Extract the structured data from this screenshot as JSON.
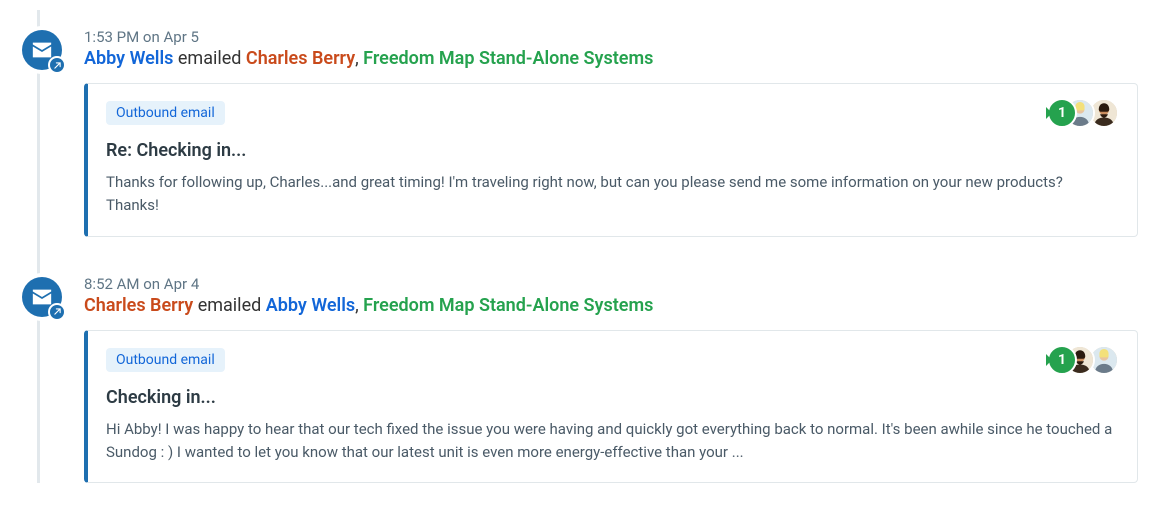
{
  "entries": [
    {
      "timestamp": "1:53 PM on Apr 5",
      "sender": {
        "name": "Abby Wells",
        "colorClass": "blue"
      },
      "action": "emailed",
      "recipient": {
        "name": "Charles Berry",
        "colorClass": "orange"
      },
      "org": "Freedom Map Stand-Alone Systems",
      "tag": "Outbound email",
      "badge_number": "1",
      "subject": "Re: Checking in...",
      "body": "Thanks for following up, Charles...and great timing! I'm traveling right now, but can you please send me some information on your new products? Thanks!",
      "avatar_order": [
        "f",
        "m"
      ]
    },
    {
      "timestamp": "8:52 AM on Apr 4",
      "sender": {
        "name": "Charles Berry",
        "colorClass": "orange"
      },
      "action": "emailed",
      "recipient": {
        "name": "Abby Wells",
        "colorClass": "blue"
      },
      "org": "Freedom Map Stand-Alone Systems",
      "tag": "Outbound email",
      "badge_number": "1",
      "subject": "Checking in...",
      "body": "Hi Abby! I was happy to hear that our tech fixed the issue you were having and quickly got everything back to normal. It's been awhile since he touched a Sundog : ) I wanted to let you know that our latest unit is even more energy-effective than your ...",
      "avatar_order": [
        "m",
        "f"
      ]
    }
  ],
  "icons": {
    "envelope": "envelope-icon",
    "arrow": "arrow-icon"
  }
}
